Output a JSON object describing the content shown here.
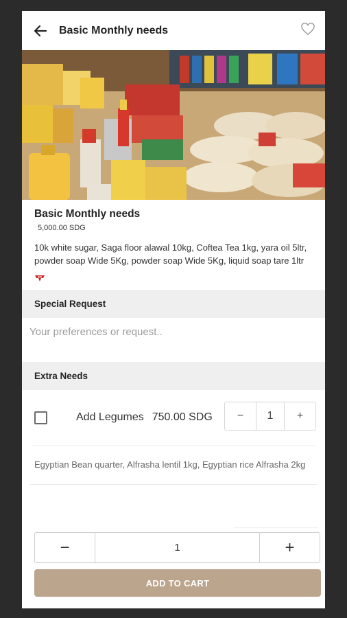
{
  "header": {
    "title": "Basic Monthly needs",
    "back_icon": "arrow-left-icon",
    "favorite_icon": "heart-outline-icon"
  },
  "product": {
    "title": "Basic Monthly needs",
    "price": "5,000.00 SDG",
    "description": "10k white sugar, Saga floor alawal 10kg, Coftea Tea 1kg, yara oil 5ltr, powder soap Wide 5Kg, powder soap Wide 5Kg, liquid soap tare 1ltr",
    "brand_logo_icon": "store-logo-icon"
  },
  "special_request": {
    "heading": "Special Request",
    "placeholder": "Your preferences or request.."
  },
  "extra_needs": {
    "heading": "Extra Needs",
    "items": [
      {
        "name": "Add Legumes",
        "price": "750.00 SDG",
        "quantity": "1",
        "minus": "−",
        "plus": "+",
        "description": "Egyptian Bean quarter, Alfrasha lentil 1kg, Egyptian rice Alfrasha 2kg"
      }
    ]
  },
  "cart": {
    "quantity": "1",
    "minus": "−",
    "plus": "+",
    "add_label": "ADD TO CART"
  },
  "colors": {
    "accent": "#bba58c",
    "brand_red": "#d0282b"
  }
}
